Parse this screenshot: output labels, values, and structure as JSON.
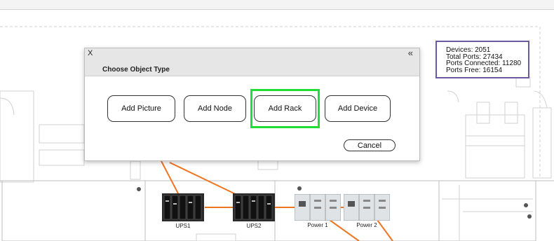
{
  "stats": {
    "devices": "Devices: 2051",
    "total_ports": "Total Ports: 27434",
    "ports_connected": "Ports Connected: 11280",
    "ports_free": "Ports Free: 16154"
  },
  "floorplan": {
    "equipment": [
      "UPS1",
      "UPS2",
      "Power 1",
      "Power 2"
    ],
    "connection_color": "#f07522",
    "highlight_color": "#22dd33"
  },
  "modal": {
    "close_label": "X",
    "collapse_label": "«",
    "title": "Choose Object Type",
    "buttons": {
      "add_picture": "Add Picture",
      "add_node": "Add Node",
      "add_rack": "Add Rack",
      "add_device": "Add Device"
    },
    "cancel": "Cancel"
  }
}
